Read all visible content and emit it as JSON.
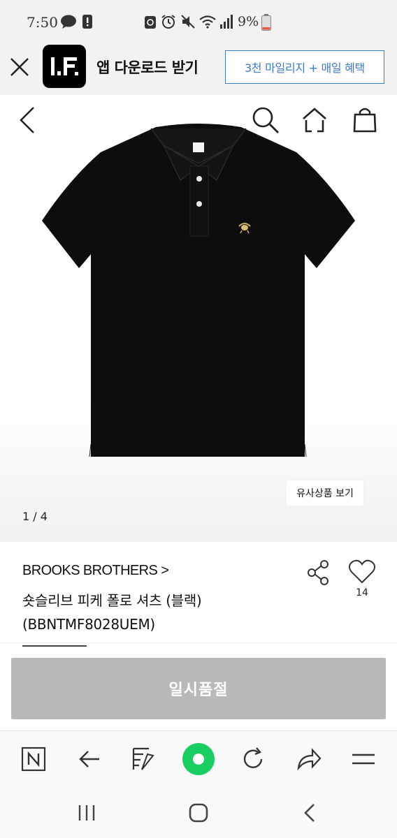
{
  "status_bar": {
    "time": "7:50",
    "battery_text": "9%",
    "icons": [
      "chat-bubble-icon",
      "alert-icon",
      "recycle-icon",
      "alarm-icon",
      "mute-icon",
      "wifi-icon",
      "signal-icon",
      "battery-icon"
    ],
    "battery_level": 0.09
  },
  "app_banner": {
    "title": "앱 다운로드 받기",
    "promo_label": "3천 마일리지 + 매일 혜택",
    "logo_text": "L.F",
    "accent_color": "#3b7bd6"
  },
  "gallery": {
    "similar_label": "유사상품 보기",
    "counter": "1 / 4"
  },
  "product": {
    "brand": "BROOKS BROTHERS >",
    "name": "숏슬리브 피케 폴로 셔츠 (블랙) (BBNTMF8028UEM)",
    "like_count": "14"
  },
  "buy": {
    "soldout_label": "일시품절",
    "soldout_color": "#b9b9b9"
  },
  "browser_toolbar": {
    "icons": [
      "naver-icon",
      "back-arrow-icon",
      "bookmark-icon",
      "green-dot-icon",
      "refresh-icon",
      "share-arrow-icon",
      "menu-icon"
    ],
    "brand_color": "#19ce60"
  },
  "android_nav": {
    "icons": [
      "recents-icon",
      "home-icon",
      "back-icon"
    ]
  }
}
